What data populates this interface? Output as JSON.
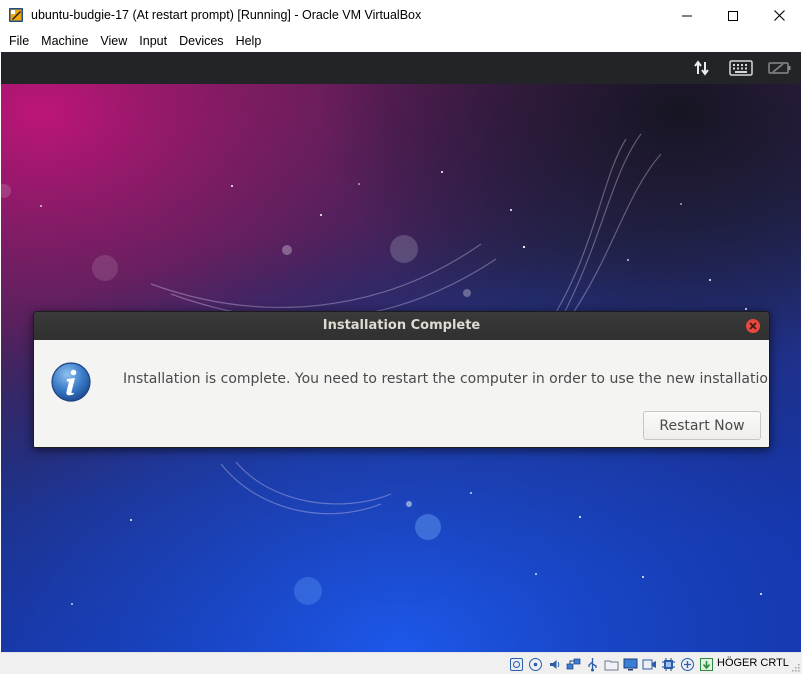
{
  "window": {
    "title": "ubuntu-budgie-17 (At restart prompt) [Running] - Oracle VM VirtualBox",
    "app_icon": "virtualbox-icon",
    "controls": [
      "minimize-icon",
      "maximize-icon",
      "close-icon"
    ]
  },
  "menu": {
    "items": [
      {
        "label": "File"
      },
      {
        "label": "Machine"
      },
      {
        "label": "View"
      },
      {
        "label": "Input"
      },
      {
        "label": "Devices"
      },
      {
        "label": "Help"
      }
    ]
  },
  "guest_panel": {
    "icons": [
      "network-transfer-icon",
      "keyboard-icon",
      "battery-icon"
    ]
  },
  "dialog": {
    "title": "Installation Complete",
    "message": "Installation is complete. You need to restart the computer in order to use the new installation.",
    "primary_button": "Restart Now",
    "icon": "info-icon",
    "close_icon": "close-icon"
  },
  "statusbar": {
    "icons": [
      "hard-disk-icon",
      "optical-drive-icon",
      "audio-icon",
      "network-icon",
      "usb-icon",
      "shared-folders-icon",
      "display-icon",
      "video-capture-icon",
      "cpu-icon",
      "mouse-integration-icon",
      "host-key-arrow-icon"
    ],
    "host_key": "HÖGER CRTL"
  },
  "colors": {
    "dialog_header": "#323232",
    "dialog_body": "#f4f4f3",
    "close_red": "#e8493e",
    "info_blue": "#3a7bc8"
  }
}
